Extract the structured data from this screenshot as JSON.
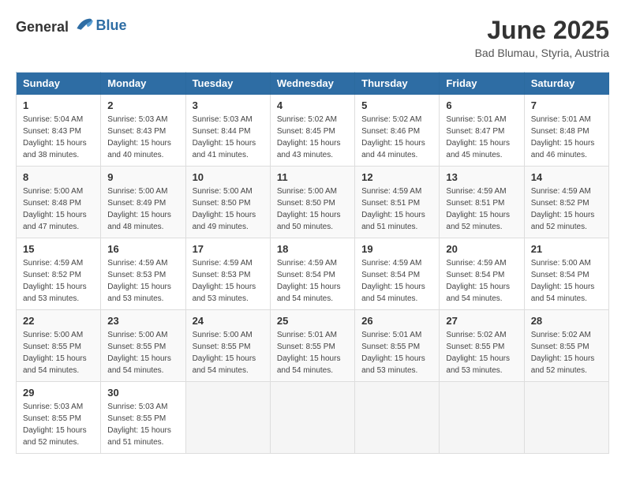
{
  "header": {
    "logo_general": "General",
    "logo_blue": "Blue",
    "title": "June 2025",
    "subtitle": "Bad Blumau, Styria, Austria"
  },
  "weekdays": [
    "Sunday",
    "Monday",
    "Tuesday",
    "Wednesday",
    "Thursday",
    "Friday",
    "Saturday"
  ],
  "weeks": [
    [
      {
        "day": "1",
        "sunrise": "5:04 AM",
        "sunset": "8:43 PM",
        "daylight": "15 hours and 38 minutes."
      },
      {
        "day": "2",
        "sunrise": "5:03 AM",
        "sunset": "8:43 PM",
        "daylight": "15 hours and 40 minutes."
      },
      {
        "day": "3",
        "sunrise": "5:03 AM",
        "sunset": "8:44 PM",
        "daylight": "15 hours and 41 minutes."
      },
      {
        "day": "4",
        "sunrise": "5:02 AM",
        "sunset": "8:45 PM",
        "daylight": "15 hours and 43 minutes."
      },
      {
        "day": "5",
        "sunrise": "5:02 AM",
        "sunset": "8:46 PM",
        "daylight": "15 hours and 44 minutes."
      },
      {
        "day": "6",
        "sunrise": "5:01 AM",
        "sunset": "8:47 PM",
        "daylight": "15 hours and 45 minutes."
      },
      {
        "day": "7",
        "sunrise": "5:01 AM",
        "sunset": "8:48 PM",
        "daylight": "15 hours and 46 minutes."
      }
    ],
    [
      {
        "day": "8",
        "sunrise": "5:00 AM",
        "sunset": "8:48 PM",
        "daylight": "15 hours and 47 minutes."
      },
      {
        "day": "9",
        "sunrise": "5:00 AM",
        "sunset": "8:49 PM",
        "daylight": "15 hours and 48 minutes."
      },
      {
        "day": "10",
        "sunrise": "5:00 AM",
        "sunset": "8:50 PM",
        "daylight": "15 hours and 49 minutes."
      },
      {
        "day": "11",
        "sunrise": "5:00 AM",
        "sunset": "8:50 PM",
        "daylight": "15 hours and 50 minutes."
      },
      {
        "day": "12",
        "sunrise": "4:59 AM",
        "sunset": "8:51 PM",
        "daylight": "15 hours and 51 minutes."
      },
      {
        "day": "13",
        "sunrise": "4:59 AM",
        "sunset": "8:51 PM",
        "daylight": "15 hours and 52 minutes."
      },
      {
        "day": "14",
        "sunrise": "4:59 AM",
        "sunset": "8:52 PM",
        "daylight": "15 hours and 52 minutes."
      }
    ],
    [
      {
        "day": "15",
        "sunrise": "4:59 AM",
        "sunset": "8:52 PM",
        "daylight": "15 hours and 53 minutes."
      },
      {
        "day": "16",
        "sunrise": "4:59 AM",
        "sunset": "8:53 PM",
        "daylight": "15 hours and 53 minutes."
      },
      {
        "day": "17",
        "sunrise": "4:59 AM",
        "sunset": "8:53 PM",
        "daylight": "15 hours and 53 minutes."
      },
      {
        "day": "18",
        "sunrise": "4:59 AM",
        "sunset": "8:54 PM",
        "daylight": "15 hours and 54 minutes."
      },
      {
        "day": "19",
        "sunrise": "4:59 AM",
        "sunset": "8:54 PM",
        "daylight": "15 hours and 54 minutes."
      },
      {
        "day": "20",
        "sunrise": "4:59 AM",
        "sunset": "8:54 PM",
        "daylight": "15 hours and 54 minutes."
      },
      {
        "day": "21",
        "sunrise": "5:00 AM",
        "sunset": "8:54 PM",
        "daylight": "15 hours and 54 minutes."
      }
    ],
    [
      {
        "day": "22",
        "sunrise": "5:00 AM",
        "sunset": "8:55 PM",
        "daylight": "15 hours and 54 minutes."
      },
      {
        "day": "23",
        "sunrise": "5:00 AM",
        "sunset": "8:55 PM",
        "daylight": "15 hours and 54 minutes."
      },
      {
        "day": "24",
        "sunrise": "5:00 AM",
        "sunset": "8:55 PM",
        "daylight": "15 hours and 54 minutes."
      },
      {
        "day": "25",
        "sunrise": "5:01 AM",
        "sunset": "8:55 PM",
        "daylight": "15 hours and 54 minutes."
      },
      {
        "day": "26",
        "sunrise": "5:01 AM",
        "sunset": "8:55 PM",
        "daylight": "15 hours and 53 minutes."
      },
      {
        "day": "27",
        "sunrise": "5:02 AM",
        "sunset": "8:55 PM",
        "daylight": "15 hours and 53 minutes."
      },
      {
        "day": "28",
        "sunrise": "5:02 AM",
        "sunset": "8:55 PM",
        "daylight": "15 hours and 52 minutes."
      }
    ],
    [
      {
        "day": "29",
        "sunrise": "5:03 AM",
        "sunset": "8:55 PM",
        "daylight": "15 hours and 52 minutes."
      },
      {
        "day": "30",
        "sunrise": "5:03 AM",
        "sunset": "8:55 PM",
        "daylight": "15 hours and 51 minutes."
      },
      null,
      null,
      null,
      null,
      null
    ]
  ]
}
